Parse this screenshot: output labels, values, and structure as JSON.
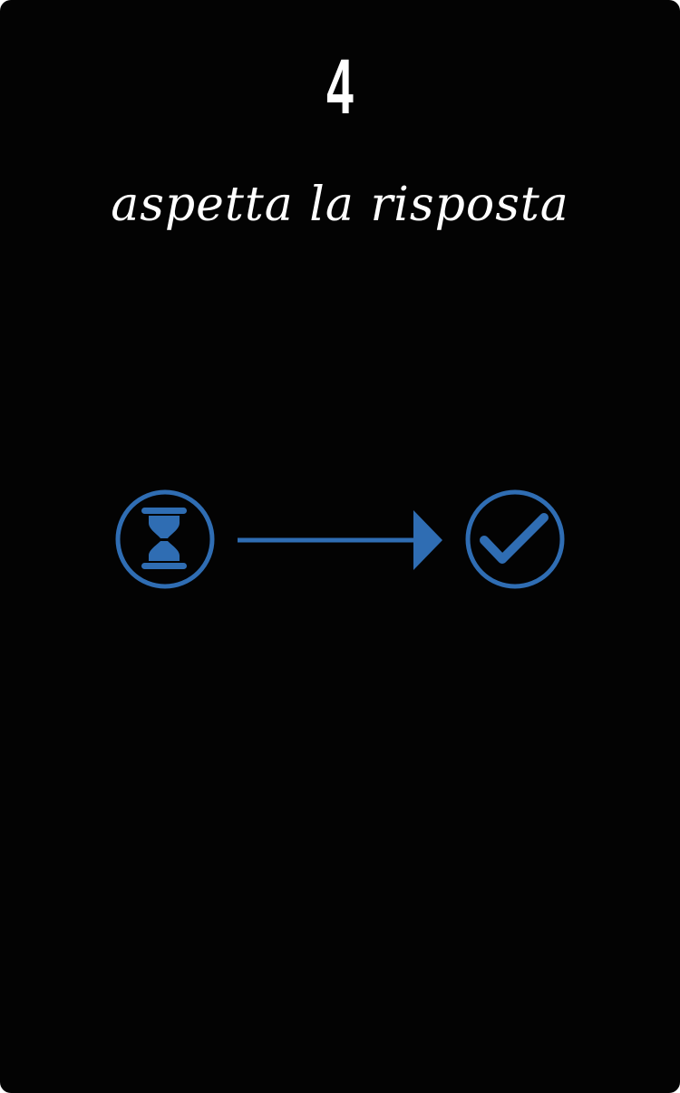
{
  "step": {
    "number": "4",
    "caption": "aspetta la risposta"
  },
  "flow": {
    "start_icon": "hourglass-icon",
    "connector_icon": "arrow-right-icon",
    "end_icon": "checkmark-icon"
  },
  "colors": {
    "background": "#030303",
    "text": "#ffffff",
    "accent": "#2f6db3"
  }
}
